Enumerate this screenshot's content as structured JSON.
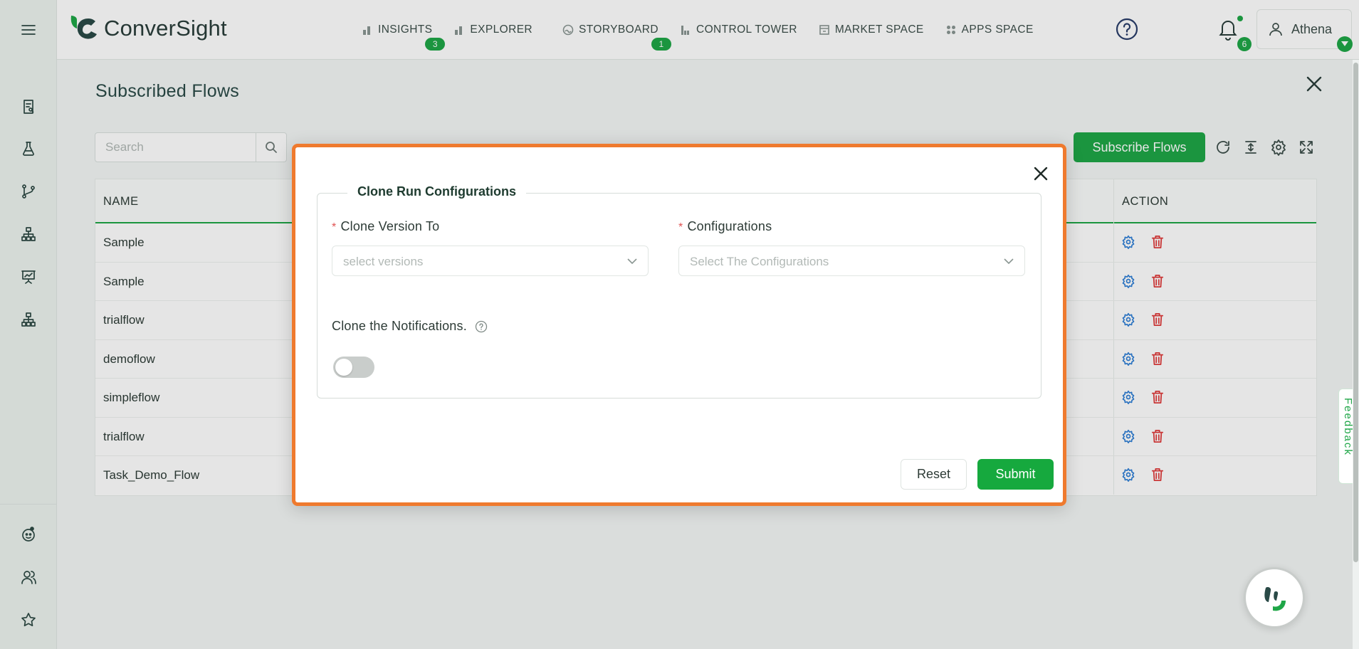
{
  "brand": {
    "name": "ConverSight",
    "accent": "#1fa647",
    "highlight": "#ef7a2e"
  },
  "nav": {
    "items": [
      {
        "label": "INSIGHTS",
        "icon": "bar-chart-icon",
        "badge": "3"
      },
      {
        "label": "EXPLORER",
        "icon": "bar-chart-icon",
        "badge": ""
      },
      {
        "label": "STORYBOARD",
        "icon": "storyboard-icon",
        "badge": "1"
      },
      {
        "label": "CONTROL TOWER",
        "icon": "tower-icon",
        "badge": ""
      },
      {
        "label": "MARKET SPACE",
        "icon": "market-icon",
        "badge": ""
      },
      {
        "label": "APPS SPACE",
        "icon": "apps-icon",
        "badge": ""
      }
    ]
  },
  "header": {
    "notifications_count": "6",
    "user_name": "Athena"
  },
  "sidebar": {
    "icons": [
      "report-icon",
      "flask-icon",
      "branch-icon",
      "hierarchy-icon",
      "presentation-icon",
      "hierarchy-icon",
      "bot-icon",
      "users-icon",
      "star-icon"
    ]
  },
  "page": {
    "title": "Subscribed Flows",
    "search_placeholder": "Search",
    "subscribe_label": "Subscribe Flows",
    "columns": {
      "name": "NAME",
      "action": "ACTION"
    },
    "rows": [
      "Sample",
      "Sample",
      "trialflow",
      "demoflow",
      "simpleflow",
      "trialflow",
      "Task_Demo_Flow"
    ]
  },
  "modal": {
    "legend": "Clone Run Configurations",
    "clone_version_label": "Clone Version To",
    "clone_version_placeholder": "select versions",
    "configurations_label": "Configurations",
    "configurations_placeholder": "Select The Configurations",
    "notifications_label": "Clone the Notifications.",
    "notifications_enabled": false,
    "required_mark": "*",
    "reset_label": "Reset",
    "submit_label": "Submit"
  },
  "feedback_label": "Feedback"
}
